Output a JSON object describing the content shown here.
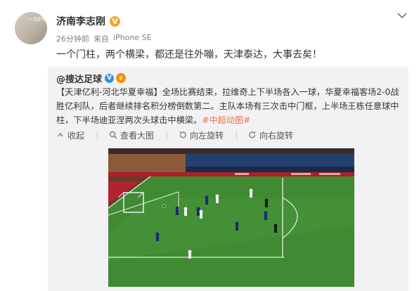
{
  "post": {
    "author": "济南李志刚",
    "verified_mark": "V",
    "time": "26分钟前",
    "source_prefix": "来自",
    "source": "iPhone SE",
    "text": "一个门柱，两个横梁，都还是往外嘣，天津泰达，大事去矣！",
    "avatar_text": "~10%"
  },
  "repost": {
    "author": "@搜达足球",
    "verified_mark": "V",
    "badge": "❦",
    "body_plain": "【天津亿利-河北华夏幸福】全场比赛结束，拉维奇上下半场各入一球，华夏幸福客场2-0战胜亿利队，后者继续排名积分榜倒数第二。主队本场有三次击中门框，上半场王栋任意球中柱，下半场迪亚涅两次头球击中横梁。",
    "hashtag": "#中超动图#"
  },
  "actions": {
    "collapse": "收起",
    "view_large": "查看大图",
    "rotate_left": "向左旋转",
    "rotate_right": "向右旋转"
  },
  "colors": {
    "name": "#333333",
    "meta": "#808080",
    "verified_gold": "#f7a325",
    "verified_blue": "#3a8ee6",
    "hashtag": "#eb7350",
    "repost_bg": "#f2f2f5",
    "pitch": "#3f8a32"
  },
  "icons": {
    "chevron": "chevron-down-icon",
    "collapse": "collapse-arrow-icon",
    "view_large": "magnifier-icon",
    "rotate_left": "rotate-left-icon",
    "rotate_right": "rotate-right-icon"
  }
}
